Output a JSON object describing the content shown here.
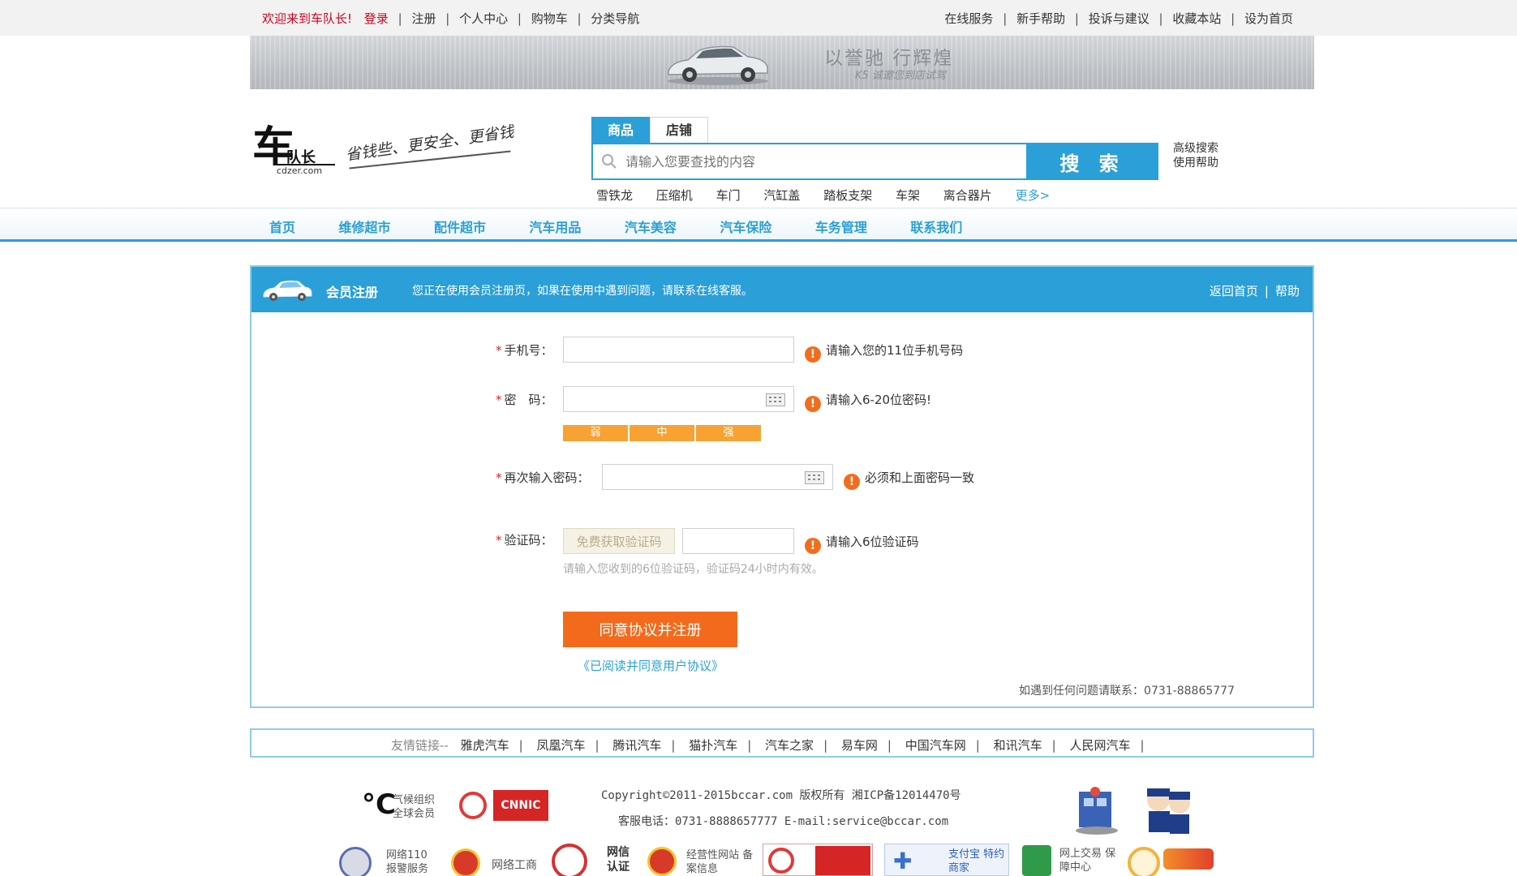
{
  "topbar": {
    "welcome": "欢迎来到车队长!",
    "login": "登录",
    "left_links": [
      "注册",
      "个人中心",
      "购物车",
      "分类导航"
    ],
    "right_links": [
      "在线服务",
      "新手帮助",
      "投诉与建议",
      "收藏本站",
      "设为首页"
    ]
  },
  "banner": {
    "slogan": "以誉驰 行辉煌",
    "sub": "K5  诚邀您到店试驾"
  },
  "logo": {
    "mark": "车",
    "team": "队长",
    "domain": "cdzer.com",
    "tagline": "省钱些、更安全、更省钱"
  },
  "search": {
    "tabs": [
      "商品",
      "店铺"
    ],
    "placeholder": "请输入您要查找的内容",
    "button": "搜 索",
    "advanced": "高级搜索",
    "help": "使用帮助",
    "hot": [
      "雪铁龙",
      "压缩机",
      "车门",
      "汽缸盖",
      "踏板支架",
      "车架",
      "离合器片"
    ],
    "more": "更多>"
  },
  "nav": [
    "首页",
    "维修超市",
    "配件超市",
    "汽车用品",
    "汽车美容",
    "汽车保险",
    "车务管理",
    "联系我们"
  ],
  "panel": {
    "title": "会员注册",
    "notice": "您正在使用会员注册页，如果在使用中遇到问题，请联系在线客服。",
    "back_home": "返回首页",
    "help": "帮助",
    "phone_label": "手机号：",
    "phone_hint": "请输入您的11位手机号码",
    "pwd_label": "密　码：",
    "pwd_hint": "请输入6-20位密码!",
    "strength": [
      "弱",
      "中",
      "强"
    ],
    "repwd_label": "再次输入密码：",
    "repwd_hint": "必须和上面密码一致",
    "code_label": "验证码：",
    "get_code": "免费获取验证码",
    "code_hint": "请输入6位验证码",
    "code_tip": "请输入您收到的6位验证码，验证码24小时内有效。",
    "submit": "同意协议并注册",
    "agree": "《已阅读并同意用户协议》",
    "contact": "如遇到任何问题请联系：0731-88865777"
  },
  "friends": {
    "lead": "友情链接--",
    "items": [
      "雅虎汽车",
      "凤凰汽车",
      "腾讯汽车",
      "猫扑汽车",
      "汽车之家",
      "易车网",
      "中国汽车网",
      "和讯汽车",
      "人民网汽车"
    ]
  },
  "footer": {
    "copyright": "Copyright©2011-2015bccar.com 版权所有 湘ICP备12014470号",
    "tel": "客服电话：0731-8888657777 E-mail:service@bccar.com",
    "badges": {
      "climate": "气候组织 全球会员",
      "cnnic": "CNNIC",
      "police": "网络110 报警服务",
      "gongshang": "网络工商",
      "credit": "网信 认证",
      "business": "经营性网站 备案信息",
      "alipay": "支付宝 特约商家",
      "trade": "网上交易 保障中心"
    }
  },
  "colors": {
    "accent": "#2a9fd8",
    "orange": "#f46a1c",
    "red": "#d0021b"
  }
}
